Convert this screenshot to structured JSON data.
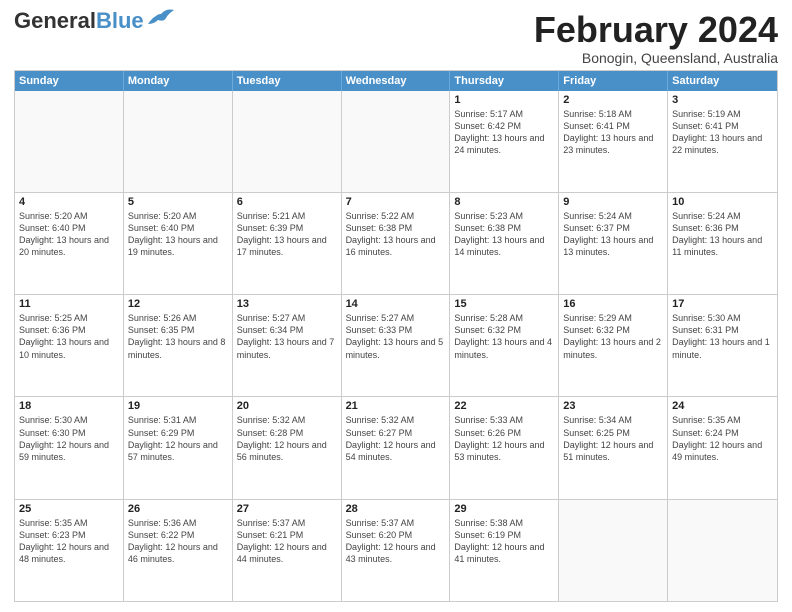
{
  "logo": {
    "line1": "General",
    "line2": "Blue"
  },
  "title": "February 2024",
  "subtitle": "Bonogin, Queensland, Australia",
  "headers": [
    "Sunday",
    "Monday",
    "Tuesday",
    "Wednesday",
    "Thursday",
    "Friday",
    "Saturday"
  ],
  "rows": [
    [
      {
        "day": "",
        "info": ""
      },
      {
        "day": "",
        "info": ""
      },
      {
        "day": "",
        "info": ""
      },
      {
        "day": "",
        "info": ""
      },
      {
        "day": "1",
        "info": "Sunrise: 5:17 AM\nSunset: 6:42 PM\nDaylight: 13 hours\nand 24 minutes."
      },
      {
        "day": "2",
        "info": "Sunrise: 5:18 AM\nSunset: 6:41 PM\nDaylight: 13 hours\nand 23 minutes."
      },
      {
        "day": "3",
        "info": "Sunrise: 5:19 AM\nSunset: 6:41 PM\nDaylight: 13 hours\nand 22 minutes."
      }
    ],
    [
      {
        "day": "4",
        "info": "Sunrise: 5:20 AM\nSunset: 6:40 PM\nDaylight: 13 hours\nand 20 minutes."
      },
      {
        "day": "5",
        "info": "Sunrise: 5:20 AM\nSunset: 6:40 PM\nDaylight: 13 hours\nand 19 minutes."
      },
      {
        "day": "6",
        "info": "Sunrise: 5:21 AM\nSunset: 6:39 PM\nDaylight: 13 hours\nand 17 minutes."
      },
      {
        "day": "7",
        "info": "Sunrise: 5:22 AM\nSunset: 6:38 PM\nDaylight: 13 hours\nand 16 minutes."
      },
      {
        "day": "8",
        "info": "Sunrise: 5:23 AM\nSunset: 6:38 PM\nDaylight: 13 hours\nand 14 minutes."
      },
      {
        "day": "9",
        "info": "Sunrise: 5:24 AM\nSunset: 6:37 PM\nDaylight: 13 hours\nand 13 minutes."
      },
      {
        "day": "10",
        "info": "Sunrise: 5:24 AM\nSunset: 6:36 PM\nDaylight: 13 hours\nand 11 minutes."
      }
    ],
    [
      {
        "day": "11",
        "info": "Sunrise: 5:25 AM\nSunset: 6:36 PM\nDaylight: 13 hours\nand 10 minutes."
      },
      {
        "day": "12",
        "info": "Sunrise: 5:26 AM\nSunset: 6:35 PM\nDaylight: 13 hours\nand 8 minutes."
      },
      {
        "day": "13",
        "info": "Sunrise: 5:27 AM\nSunset: 6:34 PM\nDaylight: 13 hours\nand 7 minutes."
      },
      {
        "day": "14",
        "info": "Sunrise: 5:27 AM\nSunset: 6:33 PM\nDaylight: 13 hours\nand 5 minutes."
      },
      {
        "day": "15",
        "info": "Sunrise: 5:28 AM\nSunset: 6:32 PM\nDaylight: 13 hours\nand 4 minutes."
      },
      {
        "day": "16",
        "info": "Sunrise: 5:29 AM\nSunset: 6:32 PM\nDaylight: 13 hours\nand 2 minutes."
      },
      {
        "day": "17",
        "info": "Sunrise: 5:30 AM\nSunset: 6:31 PM\nDaylight: 13 hours\nand 1 minute."
      }
    ],
    [
      {
        "day": "18",
        "info": "Sunrise: 5:30 AM\nSunset: 6:30 PM\nDaylight: 12 hours\nand 59 minutes."
      },
      {
        "day": "19",
        "info": "Sunrise: 5:31 AM\nSunset: 6:29 PM\nDaylight: 12 hours\nand 57 minutes."
      },
      {
        "day": "20",
        "info": "Sunrise: 5:32 AM\nSunset: 6:28 PM\nDaylight: 12 hours\nand 56 minutes."
      },
      {
        "day": "21",
        "info": "Sunrise: 5:32 AM\nSunset: 6:27 PM\nDaylight: 12 hours\nand 54 minutes."
      },
      {
        "day": "22",
        "info": "Sunrise: 5:33 AM\nSunset: 6:26 PM\nDaylight: 12 hours\nand 53 minutes."
      },
      {
        "day": "23",
        "info": "Sunrise: 5:34 AM\nSunset: 6:25 PM\nDaylight: 12 hours\nand 51 minutes."
      },
      {
        "day": "24",
        "info": "Sunrise: 5:35 AM\nSunset: 6:24 PM\nDaylight: 12 hours\nand 49 minutes."
      }
    ],
    [
      {
        "day": "25",
        "info": "Sunrise: 5:35 AM\nSunset: 6:23 PM\nDaylight: 12 hours\nand 48 minutes."
      },
      {
        "day": "26",
        "info": "Sunrise: 5:36 AM\nSunset: 6:22 PM\nDaylight: 12 hours\nand 46 minutes."
      },
      {
        "day": "27",
        "info": "Sunrise: 5:37 AM\nSunset: 6:21 PM\nDaylight: 12 hours\nand 44 minutes."
      },
      {
        "day": "28",
        "info": "Sunrise: 5:37 AM\nSunset: 6:20 PM\nDaylight: 12 hours\nand 43 minutes."
      },
      {
        "day": "29",
        "info": "Sunrise: 5:38 AM\nSunset: 6:19 PM\nDaylight: 12 hours\nand 41 minutes."
      },
      {
        "day": "",
        "info": ""
      },
      {
        "day": "",
        "info": ""
      }
    ]
  ]
}
